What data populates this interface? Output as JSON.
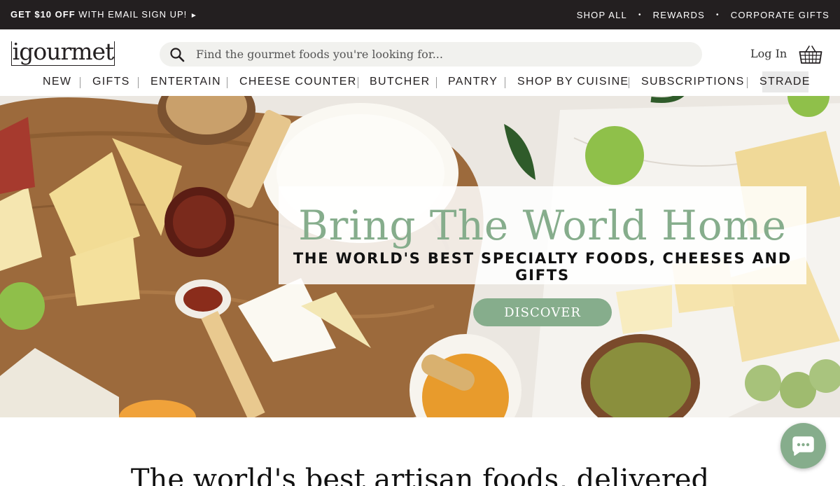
{
  "promo": {
    "signup_bold": "GET $10 OFF",
    "signup_rest": "WITH EMAIL SIGN UP!",
    "signup_arrow": "►",
    "links": [
      "SHOP ALL",
      "REWARDS",
      "CORPORATE GIFTS"
    ],
    "separator": "•"
  },
  "header": {
    "logo": "igourmet",
    "search_placeholder": "Find the gourmet foods you're looking for...",
    "login": "Log In"
  },
  "nav": {
    "items": [
      "NEW",
      "GIFTS",
      "ENTERTAIN",
      "CHEESE COUNTER",
      "BUTCHER",
      "PANTRY",
      "SHOP BY CUISINE",
      "SUBSCRIPTIONS",
      "STRADE"
    ]
  },
  "hero": {
    "title": "Bring The World Home",
    "subtitle": "THE WORLD'S BEST SPECIALTY FOODS, CHEESES AND GIFTS",
    "button": "DISCOVER"
  },
  "tagline": "The world's best artisan foods, delivered",
  "colors": {
    "accent": "#86ad8c",
    "dark": "#231f20"
  },
  "icons": {
    "search": "search-icon",
    "basket": "basket-icon",
    "chat": "chat-icon"
  }
}
